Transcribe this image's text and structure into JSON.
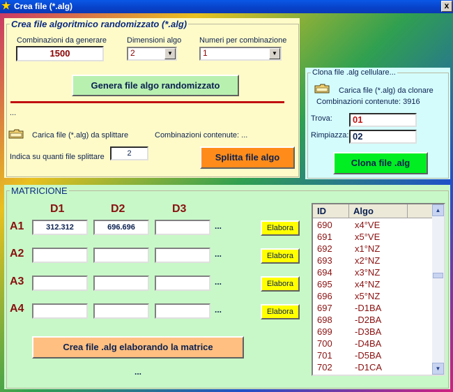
{
  "window": {
    "title": "Crea file (*.alg)",
    "close_glyph": "x"
  },
  "random_section": {
    "legend": "Crea file algoritmico randomizzato (*.alg)",
    "combinations_label": "Combinazioni da generare",
    "combinations_value": "1500",
    "dimensions_label": "Dimensioni algo",
    "dimensions_value": "2",
    "numbers_label": "Numeri per combinazione",
    "numbers_value": "1",
    "generate_button": "Genera file algo randomizzato",
    "status_dots": "...",
    "load_split_label": "Carica file (*.alg) da splittare",
    "contained_label": "Combinazioni contenute: ...",
    "split_count_label": "Indica su quanti file splittare",
    "split_count_value": "2",
    "split_button": "Splitta file algo"
  },
  "clone_section": {
    "legend": "Clona file .alg cellulare...",
    "load_label": "Carica file (*.alg) da clonare",
    "contained_label": "Combinazioni contenute: 3916",
    "find_label": "Trova:",
    "find_value": "01",
    "replace_label": "Rimpiazza:",
    "replace_value": "02",
    "clone_button": "Clona file .alg"
  },
  "matrix_section": {
    "legend": "MATRICIONE",
    "columns": [
      "D1",
      "D2",
      "D3"
    ],
    "rows": [
      {
        "label": "A1",
        "cells": [
          "312.312",
          "696.696",
          ""
        ],
        "dots": "...",
        "button": "Elabora"
      },
      {
        "label": "A2",
        "cells": [
          "",
          "",
          ""
        ],
        "dots": "...",
        "button": "Elabora"
      },
      {
        "label": "A3",
        "cells": [
          "",
          "",
          ""
        ],
        "dots": "...",
        "button": "Elabora"
      },
      {
        "label": "A4",
        "cells": [
          "",
          "",
          ""
        ],
        "dots": "...",
        "button": "Elabora"
      }
    ],
    "create_button": "Crea file .alg elaborando la matrice",
    "status_dots": "..."
  },
  "list": {
    "headers": [
      "ID",
      "Algo"
    ],
    "rows": [
      [
        "690",
        "x4°VE"
      ],
      [
        "691",
        "x5°VE"
      ],
      [
        "692",
        "x1°NZ"
      ],
      [
        "693",
        "x2°NZ"
      ],
      [
        "694",
        "x3°NZ"
      ],
      [
        "695",
        "x4°NZ"
      ],
      [
        "696",
        "x5°NZ"
      ],
      [
        "697",
        "-D1BA"
      ],
      [
        "698",
        "-D2BA"
      ],
      [
        "699",
        "-D3BA"
      ],
      [
        "700",
        "-D4BA"
      ],
      [
        "701",
        "-D5BA"
      ],
      [
        "702",
        "-D1CA"
      ]
    ]
  },
  "colors": {
    "generate_button": "#b8f0b0",
    "split_button": "#ff8c1a",
    "clone_button": "#00ee22",
    "create_button": "#ffbf80",
    "red_line": "#c01010"
  }
}
